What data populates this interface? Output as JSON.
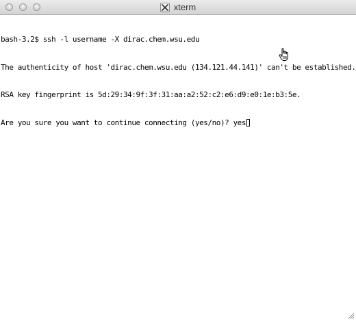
{
  "window": {
    "title": "xterm",
    "controls": [
      "close",
      "minimize",
      "zoom"
    ],
    "title_icon": "x11-icon"
  },
  "terminal": {
    "lines": [
      "bash-3.2$ ssh -l username -X dirac.chem.wsu.edu",
      "The authenticity of host 'dirac.chem.wsu.edu (134.121.44.141)' can't be established.",
      "RSA key fingerprint is 5d:29:34:9f:3f:31:aa:a2:52:c2:e6:d9:e0:1e:b3:5e.",
      "Are you sure you want to continue connecting (yes/no)? yes"
    ]
  },
  "pointer": {
    "icon": "hand-pointer-icon"
  },
  "colors": {
    "background": "#ffffff",
    "text": "#000000",
    "titlebar": "#dedede"
  }
}
